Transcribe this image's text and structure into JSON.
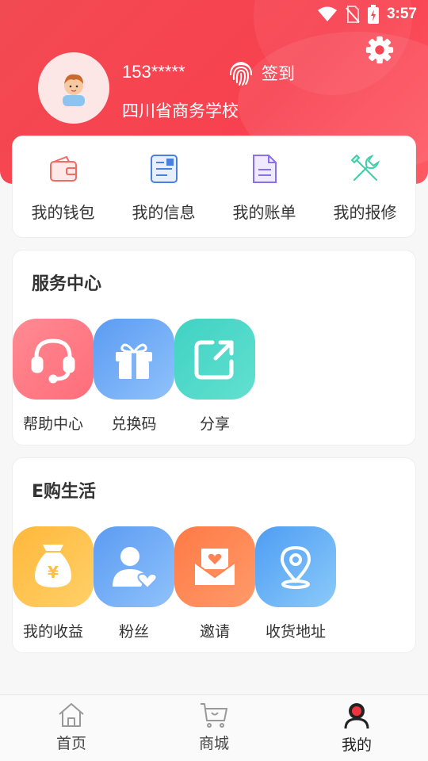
{
  "status": {
    "time": "3:57"
  },
  "profile": {
    "phone": "153*****",
    "school": "四川省商务学校",
    "signin_label": "签到"
  },
  "quick": [
    {
      "label": "我的钱包",
      "icon": "wallet-icon"
    },
    {
      "label": "我的信息",
      "icon": "info-card-icon"
    },
    {
      "label": "我的账单",
      "icon": "bill-document-icon"
    },
    {
      "label": "我的报修",
      "icon": "repair-tools-icon"
    }
  ],
  "service": {
    "title": "服务中心",
    "items": [
      {
        "label": "帮助中心",
        "icon": "headset-icon",
        "color": "#ff7b86"
      },
      {
        "label": "兑换码",
        "icon": "gift-icon",
        "color": "#6aa8f5"
      },
      {
        "label": "分享",
        "icon": "share-icon",
        "color": "#4dd6c9"
      }
    ]
  },
  "life": {
    "title": "E购生活",
    "items": [
      {
        "label": "我的收益",
        "icon": "money-bag-icon",
        "color": "#ffc24a"
      },
      {
        "label": "粉丝",
        "icon": "fans-icon",
        "color": "#6aa8f5"
      },
      {
        "label": "邀请",
        "icon": "invite-mail-icon",
        "color": "#ff8a55"
      },
      {
        "label": "收货地址",
        "icon": "location-pin-icon",
        "color": "#5aaaf7"
      }
    ]
  },
  "tabs": [
    {
      "label": "首页",
      "icon": "home-icon"
    },
    {
      "label": "商城",
      "icon": "cart-icon"
    },
    {
      "label": "我的",
      "icon": "profile-icon",
      "active": true
    }
  ]
}
